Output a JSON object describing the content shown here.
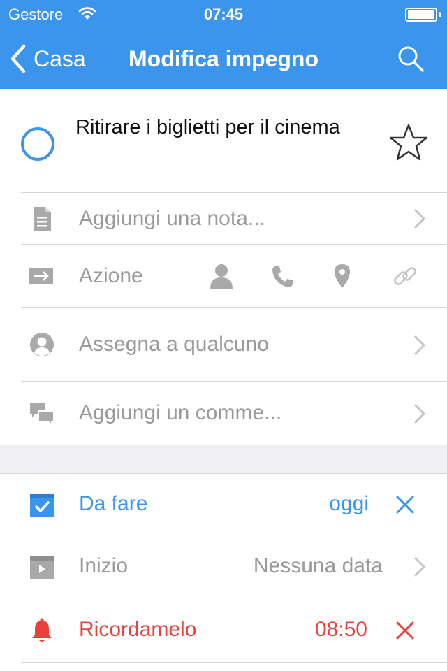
{
  "status_bar": {
    "carrier": "Gestore",
    "time": "07:45"
  },
  "nav": {
    "back_label": "Casa",
    "title": "Modifica impegno"
  },
  "task": {
    "title": "Ritirare i biglietti per il cinema"
  },
  "rows": {
    "note": {
      "label": "Aggiungi una nota..."
    },
    "action": {
      "label": "Azione"
    },
    "assign": {
      "label": "Assegna a qualcuno"
    },
    "comment": {
      "label": "Aggiungi un comme..."
    },
    "due": {
      "label": "Da fare",
      "value": "oggi"
    },
    "start": {
      "label": "Inizio",
      "value": "Nessuna data"
    },
    "reminder": {
      "label": "Ricordamelo",
      "value": "08:50"
    }
  },
  "icons": {
    "back": "chevron-left-icon",
    "search": "search-icon",
    "complete": "circle-icon",
    "star": "star-icon",
    "note": "document-icon",
    "action": "arrow-right-icon",
    "person": "person-icon",
    "phone": "phone-icon",
    "location": "location-pin-icon",
    "link": "link-icon",
    "assign": "user-circle-icon",
    "comment": "chat-bubbles-icon",
    "due": "calendar-check-icon",
    "start": "calendar-start-icon",
    "reminder": "bell-icon",
    "clear": "close-icon",
    "chevron": "chevron-right-icon"
  },
  "colors": {
    "accent": "#3b95ec",
    "alert": "#e8413a",
    "muted": "#9a9a9a",
    "divider": "#d9d9d9",
    "section_gap": "#efeff4"
  }
}
